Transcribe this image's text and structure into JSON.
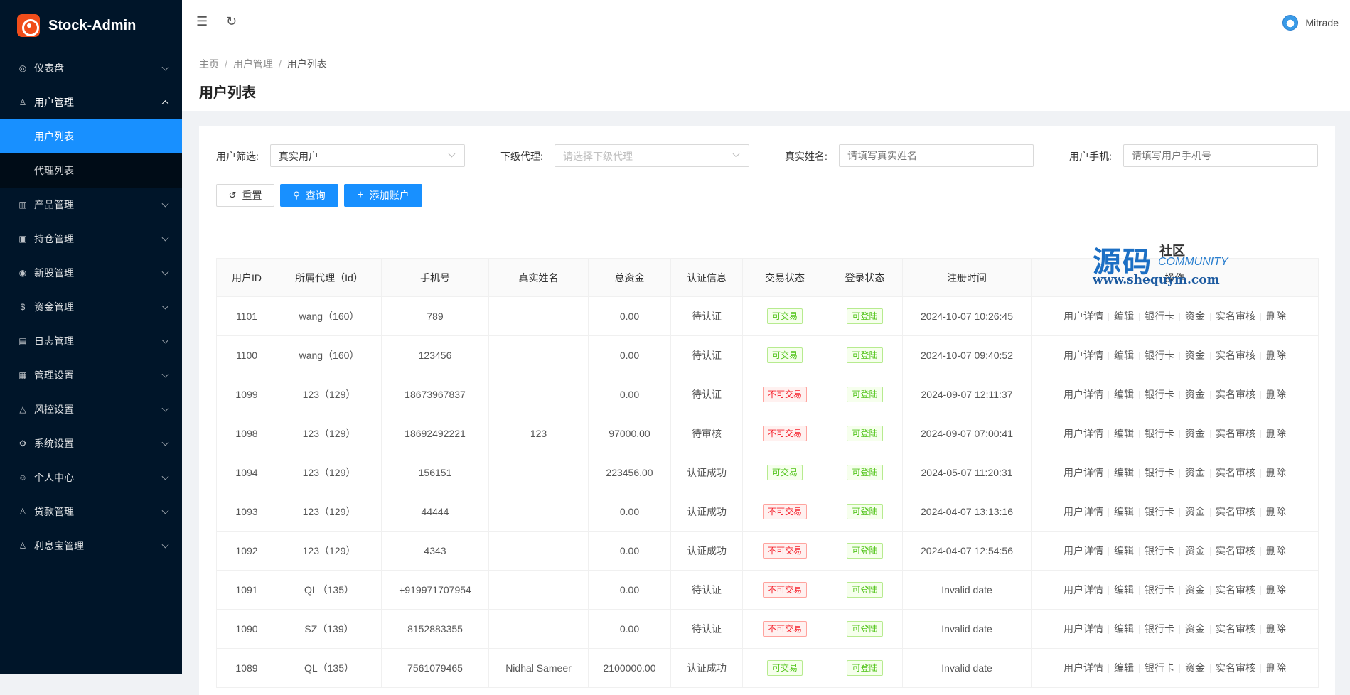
{
  "app": {
    "title": "Stock-Admin"
  },
  "sidebar": {
    "items": [
      {
        "label": "仪表盘",
        "icon": "dashboard-icon",
        "glyph": "◎"
      },
      {
        "label": "用户管理",
        "icon": "user-manage-icon",
        "glyph": "♙",
        "open": true,
        "children": [
          {
            "label": "用户列表",
            "active": true
          },
          {
            "label": "代理列表"
          }
        ]
      },
      {
        "label": "产品管理",
        "icon": "chart-icon",
        "glyph": "▥"
      },
      {
        "label": "持仓管理",
        "icon": "position-icon",
        "glyph": "▣"
      },
      {
        "label": "新股管理",
        "icon": "new-stock-icon",
        "glyph": "◉"
      },
      {
        "label": "资金管理",
        "icon": "money-icon",
        "glyph": "$"
      },
      {
        "label": "日志管理",
        "icon": "log-icon",
        "glyph": "▤"
      },
      {
        "label": "管理设置",
        "icon": "admin-settings-icon",
        "glyph": "▦"
      },
      {
        "label": "风控设置",
        "icon": "warning-icon",
        "glyph": "△"
      },
      {
        "label": "系统设置",
        "icon": "gear-icon",
        "glyph": "⚙"
      },
      {
        "label": "个人中心",
        "icon": "person-icon",
        "glyph": "☺"
      },
      {
        "label": "贷款管理",
        "icon": "loan-icon",
        "glyph": "♙"
      },
      {
        "label": "利息宝管理",
        "icon": "interest-icon",
        "glyph": "♙"
      }
    ]
  },
  "header": {
    "username": "Mitrade"
  },
  "breadcrumb": [
    "主页",
    "用户管理",
    "用户列表"
  ],
  "page_title": "用户列表",
  "filters": {
    "user_filter_label": "用户筛选:",
    "user_filter_value": "真实用户",
    "agent_label": "下级代理:",
    "agent_placeholder": "请选择下级代理",
    "realname_label": "真实姓名:",
    "realname_placeholder": "请填写真实姓名",
    "phone_label": "用户手机:",
    "phone_placeholder": "请填写用户手机号"
  },
  "buttons": {
    "reset": "重置",
    "search": "查询",
    "add": "添加账户"
  },
  "table": {
    "columns": [
      "用户ID",
      "所属代理（Id）",
      "手机号",
      "真实姓名",
      "总资金",
      "认证信息",
      "交易状态",
      "登录状态",
      "注册时间",
      "操作"
    ],
    "actions": [
      "用户详情",
      "编辑",
      "银行卡",
      "资金",
      "实名审核",
      "删除"
    ],
    "rows": [
      {
        "id": "1101",
        "agent": "wang（160）",
        "phone": "789",
        "name": "",
        "funds": "0.00",
        "auth": "待认证",
        "trade": "可交易",
        "trade_ok": true,
        "login": "可登陆",
        "time": "2024-10-07 10:26:45"
      },
      {
        "id": "1100",
        "agent": "wang（160）",
        "phone": "123456",
        "name": "",
        "funds": "0.00",
        "auth": "待认证",
        "trade": "可交易",
        "trade_ok": true,
        "login": "可登陆",
        "time": "2024-10-07 09:40:52"
      },
      {
        "id": "1099",
        "agent": "123（129）",
        "phone": "18673967837",
        "name": "",
        "funds": "0.00",
        "auth": "待认证",
        "trade": "不可交易",
        "trade_ok": false,
        "login": "可登陆",
        "time": "2024-09-07 12:11:37"
      },
      {
        "id": "1098",
        "agent": "123（129）",
        "phone": "18692492221",
        "name": "123",
        "funds": "97000.00",
        "auth": "待审核",
        "trade": "不可交易",
        "trade_ok": false,
        "login": "可登陆",
        "time": "2024-09-07 07:00:41"
      },
      {
        "id": "1094",
        "agent": "123（129）",
        "phone": "156151",
        "name": "",
        "funds": "223456.00",
        "auth": "认证成功",
        "trade": "可交易",
        "trade_ok": true,
        "login": "可登陆",
        "time": "2024-05-07 11:20:31"
      },
      {
        "id": "1093",
        "agent": "123（129）",
        "phone": "44444",
        "name": "",
        "funds": "0.00",
        "auth": "认证成功",
        "trade": "不可交易",
        "trade_ok": false,
        "login": "可登陆",
        "time": "2024-04-07 13:13:16"
      },
      {
        "id": "1092",
        "agent": "123（129）",
        "phone": "4343",
        "name": "",
        "funds": "0.00",
        "auth": "认证成功",
        "trade": "不可交易",
        "trade_ok": false,
        "login": "可登陆",
        "time": "2024-04-07 12:54:56"
      },
      {
        "id": "1091",
        "agent": "QL（135）",
        "phone": "+919971707954",
        "name": "",
        "funds": "0.00",
        "auth": "待认证",
        "trade": "不可交易",
        "trade_ok": false,
        "login": "可登陆",
        "time": "Invalid date"
      },
      {
        "id": "1090",
        "agent": "SZ（139）",
        "phone": "8152883355",
        "name": "",
        "funds": "0.00",
        "auth": "待认证",
        "trade": "不可交易",
        "trade_ok": false,
        "login": "可登陆",
        "time": "Invalid date"
      },
      {
        "id": "1089",
        "agent": "QL（135）",
        "phone": "7561079465",
        "name": "Nidhal Sameer",
        "funds": "2100000.00",
        "auth": "认证成功",
        "trade": "可交易",
        "trade_ok": true,
        "login": "可登陆",
        "time": "Invalid date"
      }
    ]
  },
  "watermark": {
    "big": "源码",
    "small": "社区",
    "eng": "COMMUNITY",
    "url": "www.shequym.com"
  },
  "colors": {
    "sidebar_bg": "#001529",
    "primary": "#1890ff",
    "ok_green": "#52c41a",
    "danger_red": "#f5222d"
  }
}
